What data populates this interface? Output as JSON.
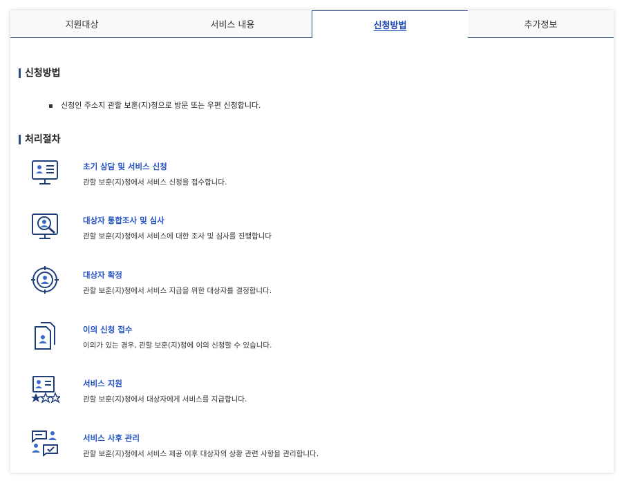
{
  "tabs": [
    {
      "label": "지원대상"
    },
    {
      "label": "서비스 내용"
    },
    {
      "label": "신청방법",
      "active": true
    },
    {
      "label": "추가정보"
    }
  ],
  "apply": {
    "heading": "신청방법",
    "items": [
      "신청인 주소지 관할 보훈(지)청으로 방문 또는 우편 신청합니다."
    ]
  },
  "process": {
    "heading": "처리절차",
    "steps": [
      {
        "icon": "monitor-profile-icon",
        "title": "초기 상담 및 서비스 신청",
        "desc": "관할 보훈(지)청에서 서비스 신청을 접수합니다."
      },
      {
        "icon": "monitor-search-user-icon",
        "title": "대상자 통합조사 및 심사",
        "desc": "관할 보훈(지)청에서 서비스에 대한 조사 및 심사를 진행합니다"
      },
      {
        "icon": "target-user-icon",
        "title": "대상자 확정",
        "desc": "관할 보훈(지)청에서 서비스 지급을 위한 대상자를 결정합니다."
      },
      {
        "icon": "document-user-icon",
        "title": "이의 신청 접수",
        "desc": "이의가 있는 경우, 관할 보훈(지)청에 이의 신청할 수 있습니다."
      },
      {
        "icon": "profile-stars-icon",
        "title": "서비스 지원",
        "desc": "관할 보훈(지)청에서 대상자에게 서비스를 지급합니다."
      },
      {
        "icon": "users-chat-check-icon",
        "title": "서비스 사후 관리",
        "desc": "관할 보훈(지)청에서 서비스 제공 이후 대상자의 상황 관련 사항을 관리합니다."
      }
    ]
  },
  "colors": {
    "accent": "#2c4a86",
    "link": "#2653c6",
    "icon": "#1f3f7a"
  }
}
